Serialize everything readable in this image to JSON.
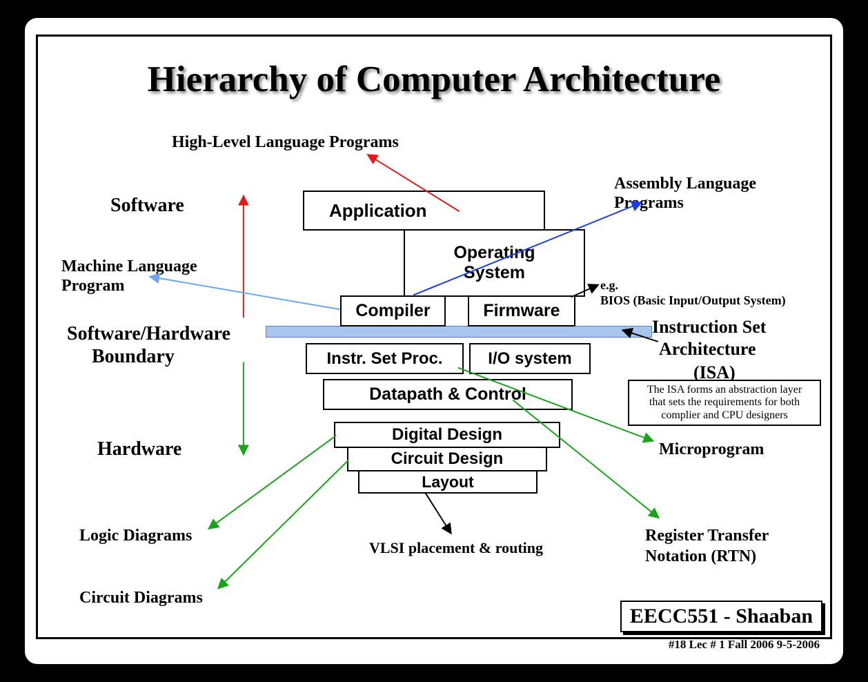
{
  "title": "Hierarchy of Computer Architecture",
  "labels": {
    "high_level": "High-Level Language Programs",
    "software": "Software",
    "machine_lang": "Machine Language",
    "program": "Program",
    "swhw_boundary1": "Software/Hardware",
    "swhw_boundary2": "Boundary",
    "hardware": "Hardware",
    "logic_diagrams": "Logic Diagrams",
    "circuit_diagrams": "Circuit Diagrams",
    "vlsi": "VLSI placement & routing",
    "assembly1": "Assembly Language",
    "assembly2": "Programs",
    "bios1": "e.g.",
    "bios2": "BIOS (Basic Input/Output System)",
    "isa1": "Instruction Set",
    "isa2": "Architecture",
    "isa3": "(ISA)",
    "microprogram": "Microprogram",
    "rtn1": "Register Transfer",
    "rtn2": "Notation (RTN)"
  },
  "boxes": {
    "application": "Application",
    "os": "Operating\nSystem",
    "compiler": "Compiler",
    "firmware": "Firmware",
    "isp": "Instr. Set Proc.",
    "io": "I/O system",
    "datapath": "Datapath & Control",
    "digital": "Digital Design",
    "circuit": "Circuit Design",
    "layout": "Layout"
  },
  "isa_note": "The ISA forms an abstraction layer\nthat sets the requirements for both\ncomplier and CPU designers",
  "footer": {
    "course": "EECC551 - Shaaban",
    "meta": "#18   Lec # 1  Fall 2006   9-5-2006"
  }
}
